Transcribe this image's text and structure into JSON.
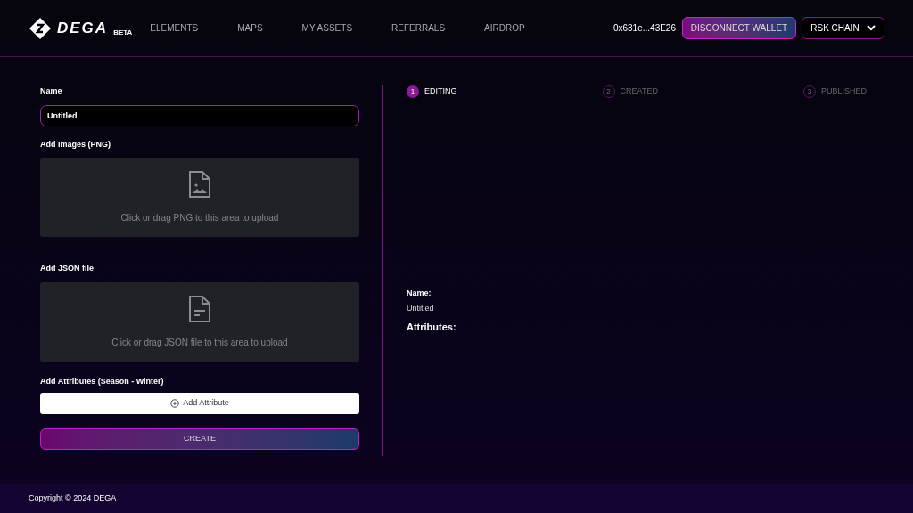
{
  "header": {
    "logo": {
      "wordmark": "DEGA",
      "badge": "BETA"
    },
    "nav": [
      {
        "label": "ELEMENTS"
      },
      {
        "label": "MAPS"
      },
      {
        "label": "MY ASSETS"
      },
      {
        "label": "REFERRALS"
      },
      {
        "label": "AIRDROP"
      }
    ],
    "wallet_address": "0x631e...43E26",
    "disconnect_button": "DISCONNECT WALLET",
    "chain_select": "RSK CHAIN"
  },
  "form": {
    "name_label": "Name",
    "name_value": "Untitled",
    "uploads": [
      {
        "label": "Add Images (PNG)",
        "kind": "image",
        "hint": "Click or drag PNG to this area to upload"
      },
      {
        "label": "Add JSON file",
        "kind": "document",
        "hint": "Click or drag JSON file to this area to upload"
      }
    ],
    "attributes_label": "Add Attributes (Season - Winter)",
    "add_attribute_button": "Add Attribute",
    "create_button": "CREATE"
  },
  "steps": [
    {
      "number": "1",
      "label": "EDITING",
      "selected": true
    },
    {
      "number": "2",
      "label": "CREATED",
      "selected": false
    },
    {
      "number": "3",
      "label": "PUBLISHED",
      "selected": false
    }
  ],
  "preview": {
    "name_label": "Name:",
    "name_value": "Untitled",
    "attributes_label": "Attributes:"
  },
  "footer": {
    "copyright": "Copyright © 2024 DEGA"
  }
}
